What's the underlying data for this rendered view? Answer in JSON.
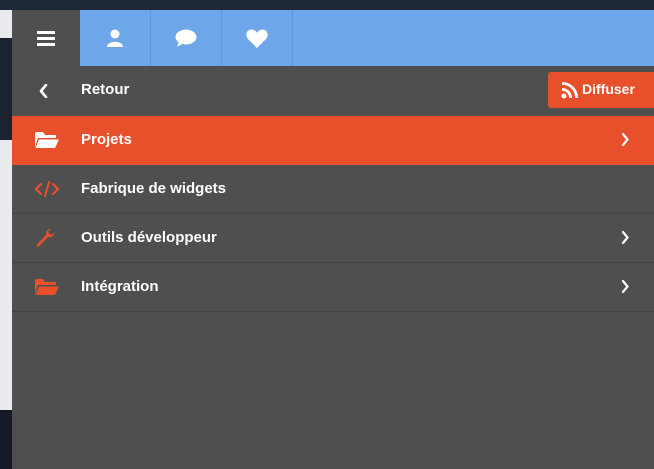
{
  "topbar": {
    "tabs": [
      {
        "icon": "hamburger-menu-icon"
      },
      {
        "icon": "user-icon"
      },
      {
        "icon": "chat-bubble-icon"
      },
      {
        "icon": "heart-icon"
      }
    ]
  },
  "header": {
    "back_label": "Retour",
    "broadcast_label": "Diffuser",
    "broadcast_icon": "rss-icon"
  },
  "menu": {
    "items": [
      {
        "label": "Projets",
        "icon": "folder-open-icon",
        "has_submenu": true,
        "active": true
      },
      {
        "label": "Fabrique de widgets",
        "icon": "code-icon",
        "has_submenu": false,
        "active": false
      },
      {
        "label": "Outils développeur",
        "icon": "wrench-icon",
        "has_submenu": true,
        "active": false
      },
      {
        "label": "Intégration",
        "icon": "folder-open-icon",
        "has_submenu": true,
        "active": false
      }
    ]
  },
  "colors": {
    "accent": "#e8502b",
    "panel": "#4f4f4f",
    "topbar": "#6ea6ea",
    "text": "#ffffff"
  }
}
